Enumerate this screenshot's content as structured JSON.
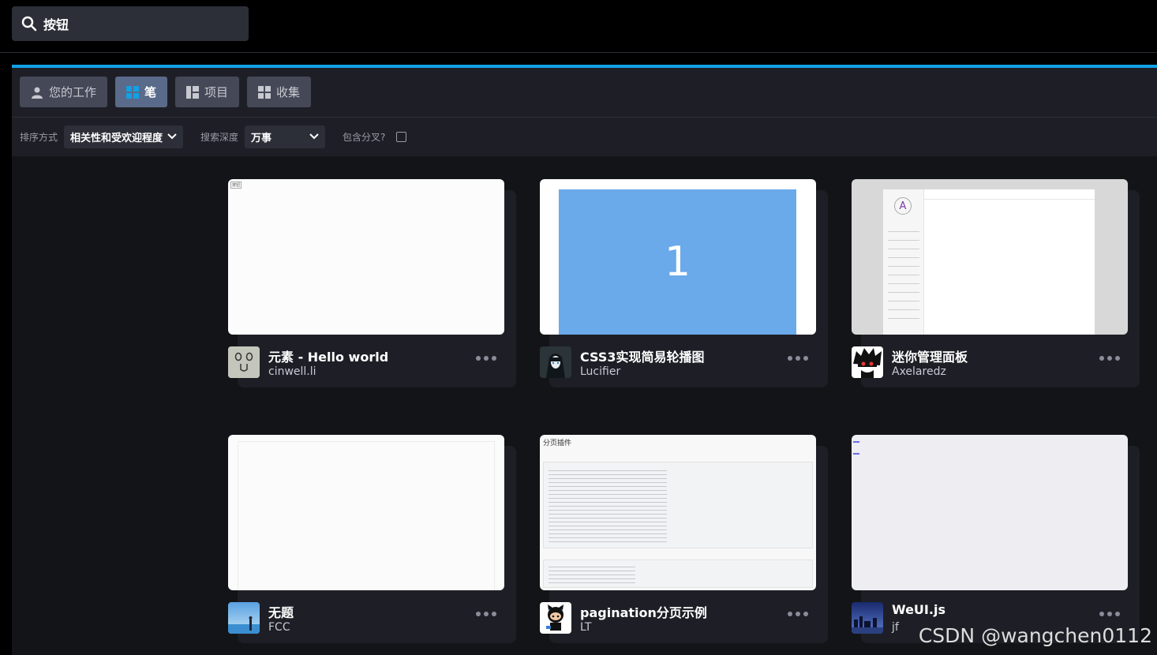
{
  "search": {
    "value": "按钮"
  },
  "tabs": [
    {
      "label": "您的工作",
      "icon": "person-icon"
    },
    {
      "label": "笔",
      "icon": "grid-icon"
    },
    {
      "label": "项目",
      "icon": "project-icon"
    },
    {
      "label": "收集",
      "icon": "collection-icon"
    }
  ],
  "filters": {
    "sort_label": "排序方式",
    "sort_value": "相关性和受欢迎程度",
    "depth_label": "搜索深度",
    "depth_value": "万事",
    "fork_label": "包含分叉?"
  },
  "cards": [
    {
      "title": "元素 - Hello world",
      "author": "cinwell.li",
      "thumb_label": "按钮"
    },
    {
      "title": "CSS3实现简易轮播图",
      "author": "Lucifier",
      "thumb_label": "1"
    },
    {
      "title": "迷你管理面板",
      "author": "Axelaredz",
      "thumb_label": "A"
    },
    {
      "title": "无题",
      "author": "FCC"
    },
    {
      "title": "pagination分页示例",
      "author": "LT",
      "thumb_label": "分页插件"
    },
    {
      "title": "WeUI.js",
      "author": "jf"
    }
  ],
  "watermark": "CSDN @wangchen0112",
  "colors": {
    "accent": "#12a0e6",
    "active_tab": "#5a6a8a",
    "slide_blue": "#6aa9ea"
  }
}
